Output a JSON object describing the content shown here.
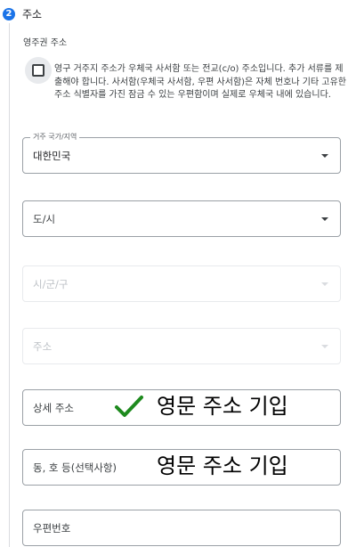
{
  "step": {
    "number": "2",
    "title": "주소"
  },
  "section": {
    "heading": "영주권 주소"
  },
  "po_box_checkbox": {
    "checked": false,
    "label": "영구 거주지 주소가 우체국 사서함 또는 전교(c/o) 주소입니다. 추가 서류를 제출해야 합니다. 사서함(우체국 사서함, 우편 사서함)은 자체 번호나 기타 고유한 주소 식별자를 가진 잠금 수 있는 우편함이며 실제로 우체국 내에 있습니다."
  },
  "fields": {
    "country": {
      "label": "거주 국가/지역",
      "value": "대한민국"
    },
    "province": {
      "placeholder": "도/시"
    },
    "city": {
      "placeholder": "시/군/구"
    },
    "address": {
      "placeholder": "주소"
    },
    "detail": {
      "placeholder": "상세 주소"
    },
    "building": {
      "placeholder": "동, 호 등(선택사항)"
    },
    "postal": {
      "placeholder": "우편번호"
    }
  },
  "annotations": {
    "detail_note": "영문 주소 기입",
    "building_note": "영문 주소 기입",
    "check_color": "#1e8a1e"
  },
  "colors": {
    "accent": "#1a73e8",
    "border": "#9aa0a6",
    "disabled_border": "#e8eaed"
  }
}
